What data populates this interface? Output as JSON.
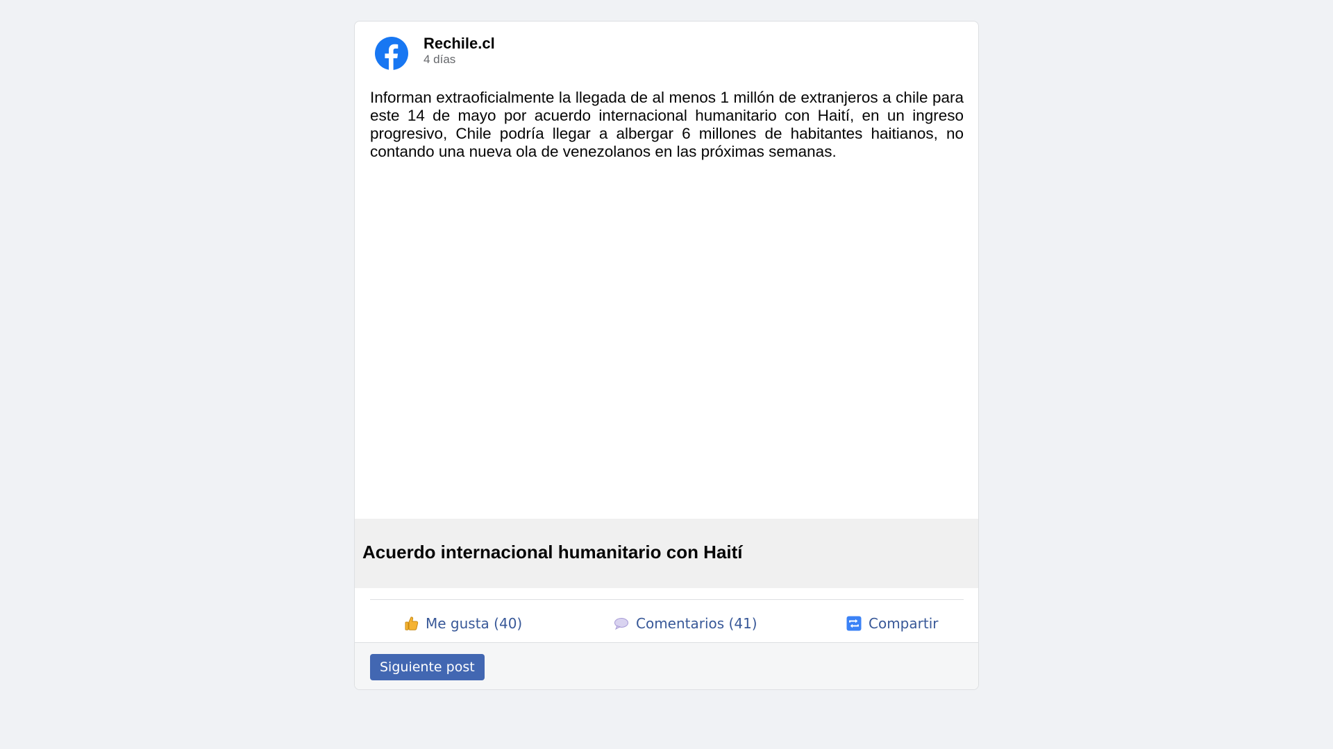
{
  "post": {
    "page_name": "Rechile.cl",
    "time": "4 días",
    "body": "Informan extraoficialmente la llegada de al menos 1 millón de extranjeros a chile para este 14 de mayo por acuerdo internacional humanitario con Haití, en un ingreso progresivo, Chile podría llegar a albergar 6 millones de habitantes haitianos, no contando una nueva ola de venezolanos en las próximas semanas.",
    "link_title": "Acuerdo internacional humanitario con Haití"
  },
  "actions": {
    "like_label": "Me gusta (40)",
    "comment_label": "Comentarios (41)",
    "share_label": "Compartir"
  },
  "footer": {
    "next_label": "Siguiente post"
  },
  "icons": {
    "page_avatar": "facebook-logo-icon",
    "like": "thumbs-up-icon",
    "comment": "speech-bubble-icon",
    "share": "share-arrows-icon"
  },
  "colors": {
    "brand_blue": "#1877f2",
    "link_blue": "#385898",
    "button_blue": "#4267b2",
    "background": "#f0f2f5"
  }
}
